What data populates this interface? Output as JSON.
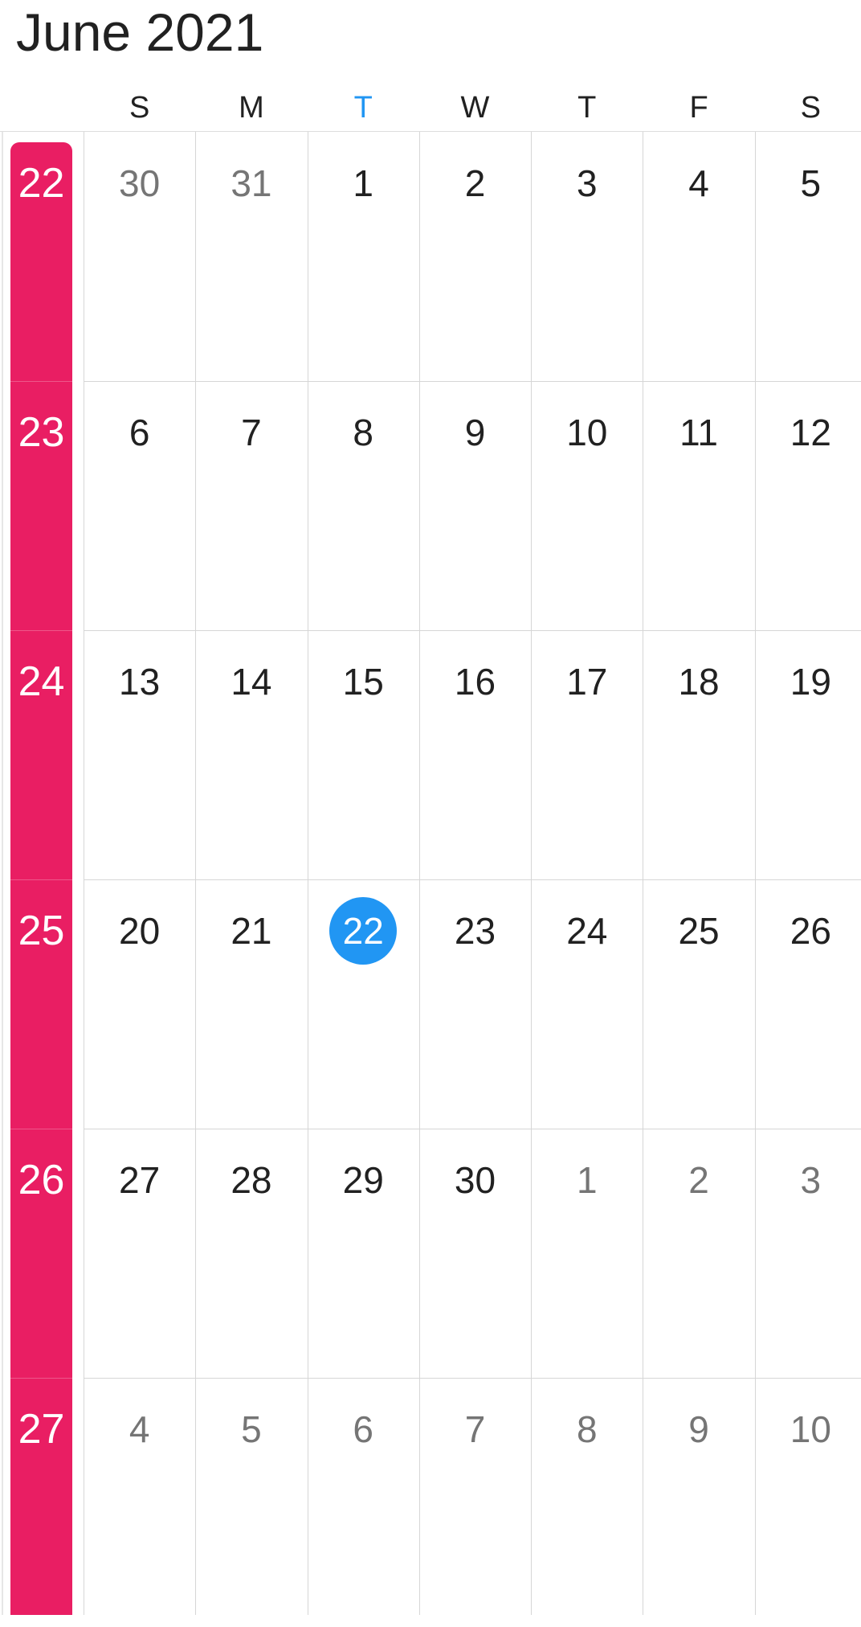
{
  "header": {
    "title": "June 2021"
  },
  "weekdays": [
    "S",
    "M",
    "T",
    "W",
    "T",
    "F",
    "S"
  ],
  "today_weekday_index": 2,
  "colors": {
    "week_strip": "#e91e63",
    "today": "#2196f3",
    "text": "#212121",
    "muted_text": "#757575",
    "grid_line": "#d6d6d6"
  },
  "weeks": [
    {
      "week_number": "22",
      "days": [
        {
          "label": "30",
          "muted": true
        },
        {
          "label": "31",
          "muted": true
        },
        {
          "label": "1",
          "muted": false
        },
        {
          "label": "2",
          "muted": false
        },
        {
          "label": "3",
          "muted": false
        },
        {
          "label": "4",
          "muted": false
        },
        {
          "label": "5",
          "muted": false
        }
      ]
    },
    {
      "week_number": "23",
      "days": [
        {
          "label": "6",
          "muted": false
        },
        {
          "label": "7",
          "muted": false
        },
        {
          "label": "8",
          "muted": false
        },
        {
          "label": "9",
          "muted": false
        },
        {
          "label": "10",
          "muted": false
        },
        {
          "label": "11",
          "muted": false
        },
        {
          "label": "12",
          "muted": false
        }
      ]
    },
    {
      "week_number": "24",
      "days": [
        {
          "label": "13",
          "muted": false
        },
        {
          "label": "14",
          "muted": false
        },
        {
          "label": "15",
          "muted": false
        },
        {
          "label": "16",
          "muted": false
        },
        {
          "label": "17",
          "muted": false
        },
        {
          "label": "18",
          "muted": false
        },
        {
          "label": "19",
          "muted": false
        }
      ]
    },
    {
      "week_number": "25",
      "days": [
        {
          "label": "20",
          "muted": false
        },
        {
          "label": "21",
          "muted": false
        },
        {
          "label": "22",
          "muted": false,
          "today": true
        },
        {
          "label": "23",
          "muted": false
        },
        {
          "label": "24",
          "muted": false
        },
        {
          "label": "25",
          "muted": false
        },
        {
          "label": "26",
          "muted": false
        }
      ]
    },
    {
      "week_number": "26",
      "days": [
        {
          "label": "27",
          "muted": false
        },
        {
          "label": "28",
          "muted": false
        },
        {
          "label": "29",
          "muted": false
        },
        {
          "label": "30",
          "muted": false
        },
        {
          "label": "1",
          "muted": true
        },
        {
          "label": "2",
          "muted": true
        },
        {
          "label": "3",
          "muted": true
        }
      ]
    },
    {
      "week_number": "27",
      "days": [
        {
          "label": "4",
          "muted": true
        },
        {
          "label": "5",
          "muted": true
        },
        {
          "label": "6",
          "muted": true
        },
        {
          "label": "7",
          "muted": true
        },
        {
          "label": "8",
          "muted": true
        },
        {
          "label": "9",
          "muted": true
        },
        {
          "label": "10",
          "muted": true
        }
      ]
    }
  ]
}
